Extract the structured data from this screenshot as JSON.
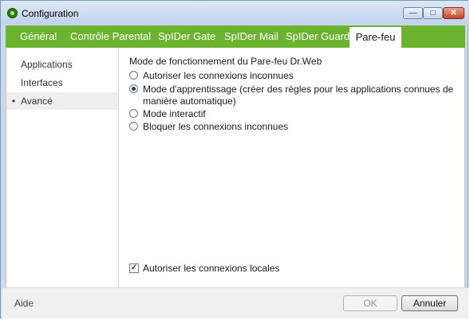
{
  "window": {
    "title": "Configuration",
    "minimize": "—",
    "maximize": "□",
    "close": "✕"
  },
  "tabs": [
    {
      "label": "Général"
    },
    {
      "label": "Contrôle Parental"
    },
    {
      "label": "SpIDer Gate"
    },
    {
      "label": "SpIDer Mail"
    },
    {
      "label": "SpIDer Guard"
    },
    {
      "label": "Pare-feu",
      "active": true
    }
  ],
  "sidebar": {
    "items": [
      {
        "label": "Applications"
      },
      {
        "label": "Interfaces"
      },
      {
        "label": "Avancé",
        "active": true
      }
    ],
    "bullet": "•"
  },
  "main": {
    "section_title": "Mode de fonctionnement du Pare-feu Dr.Web",
    "options": [
      {
        "label": "Autoriser les connexions inconnues",
        "checked": false
      },
      {
        "label": "Mode d'apprentissage (créer des règles pour les applications connues de manière automatique)",
        "checked": true
      },
      {
        "label": "Mode interactif",
        "checked": false
      },
      {
        "label": "Bloquer les connexions inconnues",
        "checked": false
      }
    ],
    "local_connections": {
      "label": "Autoriser les connexions locales",
      "checked": true,
      "mark": "✓"
    }
  },
  "footer": {
    "help": "Aide",
    "ok": "OK",
    "cancel": "Annuler"
  },
  "colors": {
    "tab_bar": "#6cb330",
    "window_frame": "#c9daf0"
  }
}
